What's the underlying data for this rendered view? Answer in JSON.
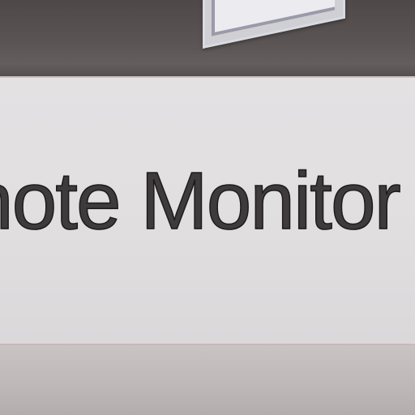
{
  "photo": {
    "sign_text": "note Monitor",
    "colors": {
      "card": "#e1dfe0",
      "text": "#3f3b3c",
      "backdrop": "#524c4d"
    }
  }
}
